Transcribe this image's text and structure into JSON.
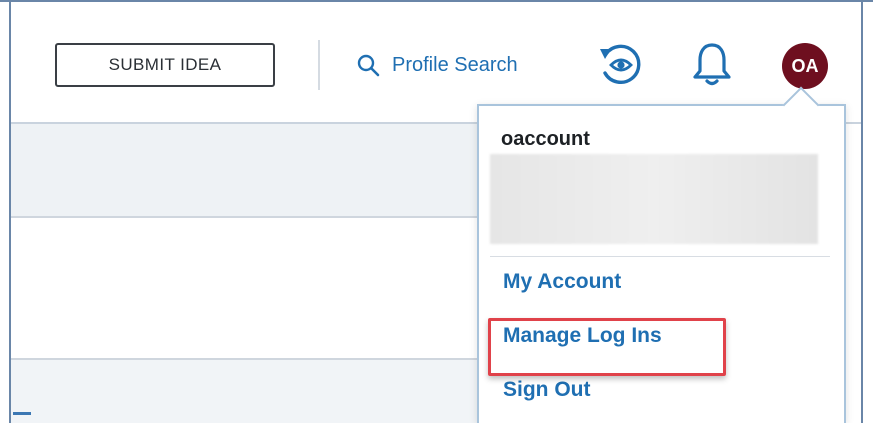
{
  "header": {
    "submit_label": "SUBMIT IDEA",
    "search_label": "Profile Search",
    "avatar_initials": "OA"
  },
  "icons": {
    "search": "search-icon",
    "recent": "recently-viewed-icon",
    "notifications": "bell-icon"
  },
  "user_menu": {
    "username": "oaccount",
    "items": [
      {
        "label": "My Account"
      },
      {
        "label": "Manage Log Ins",
        "highlighted": true
      },
      {
        "label": "Sign Out"
      }
    ]
  },
  "colors": {
    "link": "#1f6fb2",
    "avatar_bg": "#6e0f1f",
    "highlight": "#e0424a",
    "frame": "#6a86a8"
  }
}
